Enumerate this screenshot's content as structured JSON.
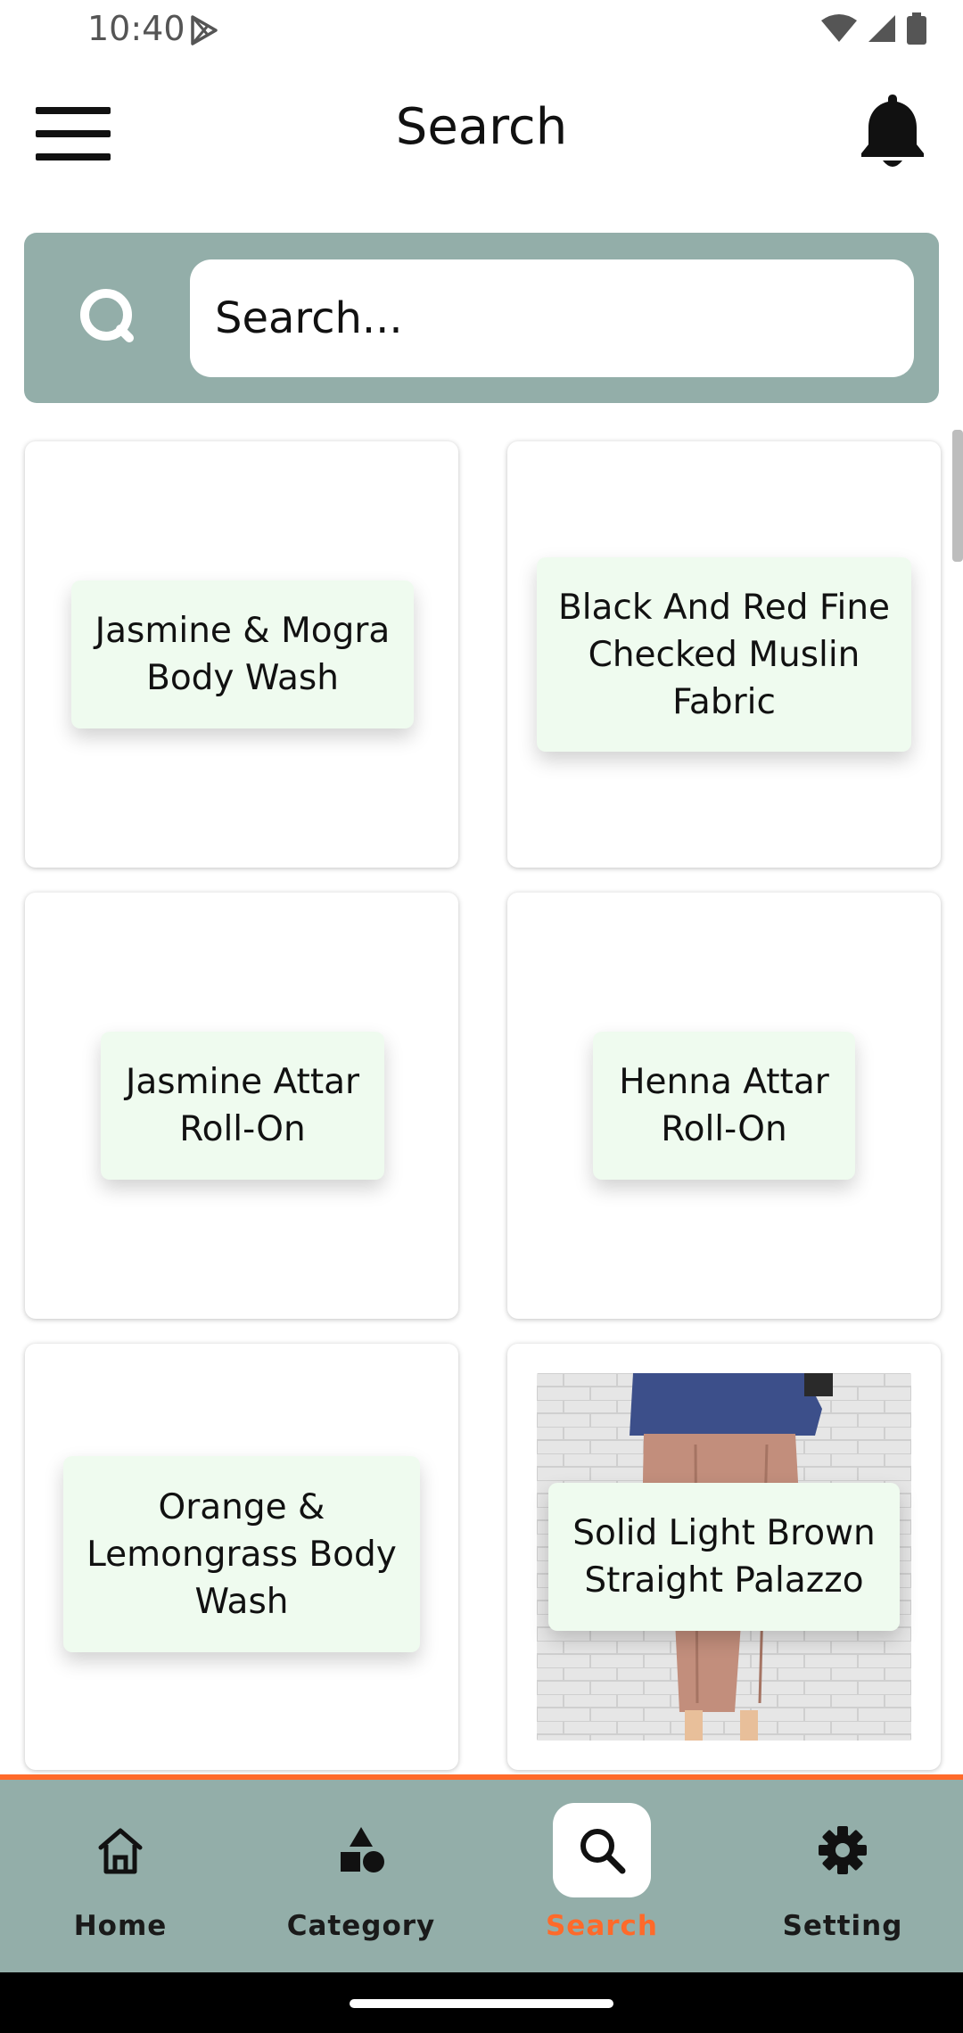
{
  "status_bar": {
    "time": "10:40"
  },
  "header": {
    "title": "Search"
  },
  "search": {
    "placeholder": "Search..."
  },
  "products": [
    {
      "name": "Jasmine & Mogra Body Wash"
    },
    {
      "name": "Black And Red Fine Checked Muslin Fabric"
    },
    {
      "name": "Jasmine Attar Roll-On"
    },
    {
      "name": "Henna Attar Roll-On"
    },
    {
      "name": "Orange & Lemongrass Body Wash"
    },
    {
      "name": "Solid Light Brown Straight Palazzo"
    }
  ],
  "bottom_nav": {
    "items": [
      {
        "label": "Home",
        "icon": "home-icon"
      },
      {
        "label": "Category",
        "icon": "shapes-icon"
      },
      {
        "label": "Search",
        "icon": "search-icon",
        "active": true
      },
      {
        "label": "Setting",
        "icon": "gear-icon"
      }
    ]
  },
  "colors": {
    "panel": "#93aea9",
    "accent": "#ff6a2a",
    "label_bg": "#effbef"
  }
}
